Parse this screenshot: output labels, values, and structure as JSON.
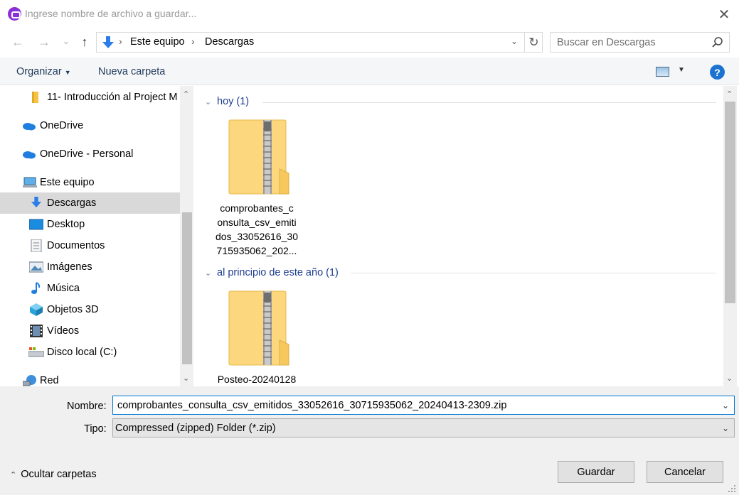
{
  "window": {
    "title": "Ingrese nombre de archivo a guardar...",
    "close_glyph": "✕"
  },
  "nav": {
    "back_glyph": "←",
    "forward_glyph": "→",
    "recent_glyph": "⌄",
    "up_glyph": "↑",
    "breadcrumb": [
      "Este equipo",
      "Descargas"
    ],
    "refresh_glyph": "↻",
    "search_placeholder": "Buscar en Descargas"
  },
  "toolbar": {
    "organize_label": "Organizar",
    "new_folder_label": "Nueva carpeta",
    "help_glyph": "?"
  },
  "sidebar": {
    "items": [
      {
        "label": "11- Introducción al Project M",
        "icon": "folder-icon"
      },
      {
        "label": "OneDrive",
        "icon": "onedrive-icon"
      },
      {
        "label": "OneDrive - Personal",
        "icon": "onedrive-icon"
      },
      {
        "label": "Este equipo",
        "icon": "computer-icon"
      },
      {
        "label": "Descargas",
        "icon": "downloads-icon",
        "selected": true
      },
      {
        "label": "Desktop",
        "icon": "desktop-icon"
      },
      {
        "label": "Documentos",
        "icon": "documents-icon"
      },
      {
        "label": "Imágenes",
        "icon": "pictures-icon"
      },
      {
        "label": "Música",
        "icon": "music-icon"
      },
      {
        "label": "Objetos 3D",
        "icon": "3d-objects-icon"
      },
      {
        "label": "Vídeos",
        "icon": "videos-icon"
      },
      {
        "label": "Disco local (C:)",
        "icon": "local-disk-icon"
      },
      {
        "label": "Red",
        "icon": "network-icon"
      }
    ]
  },
  "content": {
    "groups": [
      {
        "header": "hoy (1)",
        "files": [
          {
            "name_lines": [
              "comprobantes_c",
              "onsulta_csv_emiti",
              "dos_33052616_30",
              "715935062_202..."
            ],
            "icon": "zip-folder-icon"
          }
        ]
      },
      {
        "header": "al principio de este año (1)",
        "files": [
          {
            "name_lines": [
              "Posteo-20240128"
            ],
            "icon": "zip-folder-icon"
          }
        ]
      }
    ]
  },
  "form": {
    "name_label": "Nombre:",
    "name_value": "comprobantes_consulta_csv_emitidos_33052616_30715935062_20240413-2309.zip",
    "type_label": "Tipo:",
    "type_value": "Compressed (zipped) Folder (*.zip)"
  },
  "footer": {
    "hide_folders_label": "Ocultar carpetas",
    "save_label": "Guardar",
    "cancel_label": "Cancelar"
  },
  "colors": {
    "accent": "#0078d7",
    "selection": "#d9d9d9",
    "group_header": "#1e3d8f",
    "folder_yellow": "#ffe08a"
  }
}
